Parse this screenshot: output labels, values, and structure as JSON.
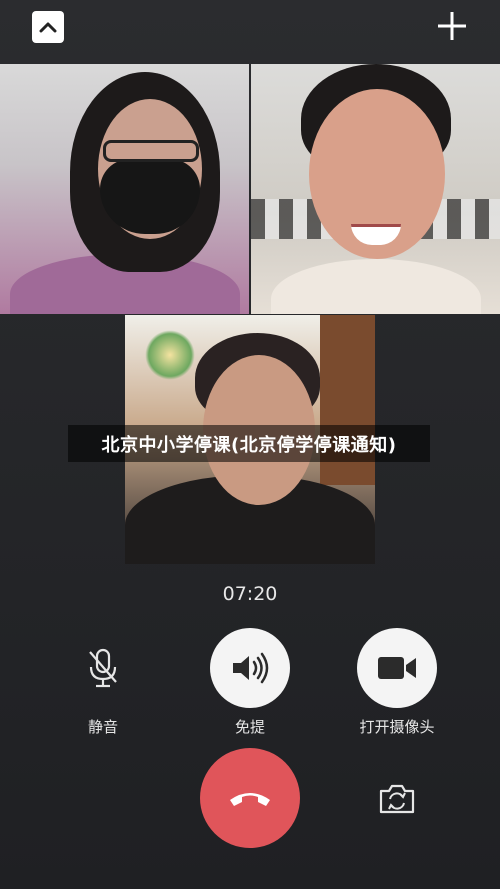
{
  "caption": "北京中小学停课(北京停学停课通知)",
  "call": {
    "timer": "07:20"
  },
  "controls": {
    "mute_label": "静音",
    "speaker_label": "免提",
    "camera_label": "打开摄像头"
  },
  "colors": {
    "hangup": "#e0555a",
    "background": "#252629",
    "button_white": "#f4f4f4"
  },
  "icons": {
    "top_left": "chevron-up-icon",
    "top_right": "plus-icon",
    "mute": "mic-off-icon",
    "speaker": "speaker-icon",
    "camera": "video-camera-icon",
    "hangup": "phone-hangup-icon",
    "switch": "switch-camera-icon"
  }
}
